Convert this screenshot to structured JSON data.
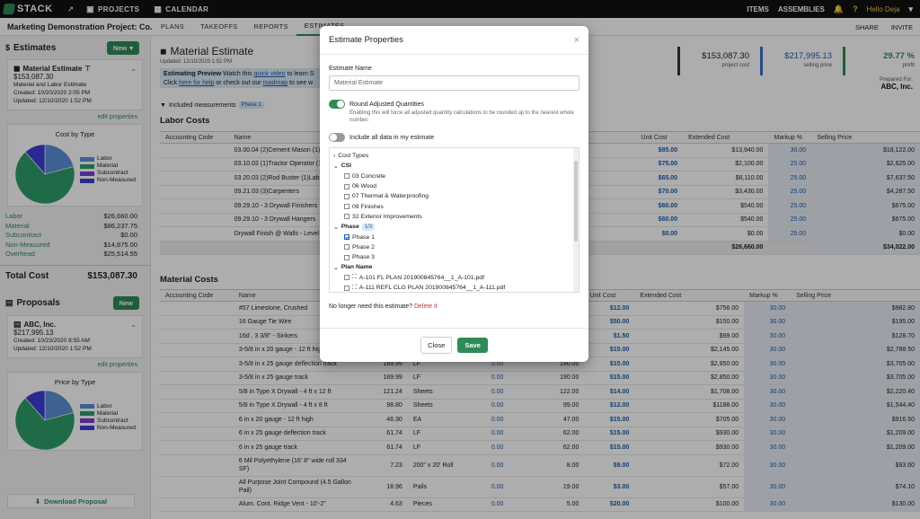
{
  "topbar": {
    "logo": "STACK",
    "projects": "PROJECTS",
    "calendar": "CALENDAR",
    "items": "ITEMS",
    "assemblies": "ASSEMBLIES",
    "hello": "Hello Deja"
  },
  "subbar": {
    "project": "Marketing Demonstration Project: Co...",
    "tabs": [
      "PLANS",
      "TAKEOFFS",
      "REPORTS",
      "ESTIMATES"
    ],
    "share": "SHARE",
    "invite": "INVITE"
  },
  "sidebar": {
    "estimates_title": "Estimates",
    "new_label": "New",
    "estimate_card": {
      "title": "Material Estimate",
      "amount": "$153,087.30",
      "desc": "Material and Labor Estimate",
      "created": "Created: 10/20/2020 2:05 PM",
      "updated": "Updated: 12/10/2020 1:52 PM"
    },
    "edit_properties": "edit properties",
    "cost_by_type": "Cost by Type",
    "legend": [
      "Labor",
      "Material",
      "Subcontract",
      "Non-Measured"
    ],
    "costs": [
      {
        "k": "Labor",
        "v": "$26,660.00"
      },
      {
        "k": "Material",
        "v": "$86,237.75"
      },
      {
        "k": "Subcontract",
        "v": "$0.00"
      },
      {
        "k": "Non-Measured",
        "v": "$14,675.00"
      },
      {
        "k": "Overhead",
        "v": "$25,514.55"
      }
    ],
    "total_label": "Total Cost",
    "total_value": "$153,087.30",
    "proposals_title": "Proposals",
    "proposal_new": "New",
    "proposal_card": {
      "title": "ABC, Inc.",
      "amount": "$217,995.13",
      "created": "Created: 10/23/2020 8:55 AM",
      "updated": "Updated: 12/10/2020 1:52 PM"
    },
    "edit_properties_2": "edit properties",
    "price_by_type": "Price by Type",
    "download": "Download Proposal"
  },
  "colors": {
    "labor": "#5b8fd6",
    "material": "#2e9e6a",
    "subcontract": "#7a3fd0",
    "non_measured": "#3d3dd6",
    "accent": "#2e8b57"
  },
  "main": {
    "title": "Material Estimate",
    "updated": "Updated: 12/10/2020 1:52 PM",
    "preview_line1_a": "Estimating Preview",
    "preview_line1_b": "Watch this",
    "preview_link1": "quick video",
    "preview_line1_c": "to learn S",
    "preview_line2_a": "Click",
    "preview_link2": "here for help",
    "preview_line2_b": "or check out our",
    "preview_link3": "roadmap",
    "preview_line2_c": "to see w",
    "included": "Included measurements",
    "phase_badge": "Phase 1",
    "kpis": [
      {
        "v": "$153,087.30",
        "l": "project cost"
      },
      {
        "v": "$217,995.13",
        "l": "selling price"
      },
      {
        "v": "29.77 %",
        "l": "profit"
      }
    ],
    "prepared_for": "Prepared For:",
    "prepared_name": "ABC, Inc.",
    "labor_title": "Labor Costs",
    "material_title": "Material Costs",
    "headers": {
      "acct": "Accounting Code",
      "name": "Name",
      "unit_cost": "Unit Cost",
      "ext": "Extended Cost",
      "markup": "Markup %",
      "selling": "Selling Price"
    },
    "labor_rows": [
      {
        "name": "03.00.04 (2)Cement Mason (1)",
        "uc": "$85.00",
        "ext": "$13,940.00",
        "mk": "30.00",
        "sp": "$18,122.00"
      },
      {
        "name": "03.10.02 (1)Tractor Operator (1)",
        "uc": "$75.00",
        "ext": "$2,100.00",
        "mk": "25.00",
        "sp": "$2,625.00"
      },
      {
        "name": "03.20.03 (2)Rod Buster (1)Lab",
        "uc": "$65.00",
        "ext": "$6,110.00",
        "mk": "25.00",
        "sp": "$7,637.50"
      },
      {
        "name": "09.21.03 (3)Carpenters",
        "uc": "$70.00",
        "ext": "$3,430.00",
        "mk": "25.00",
        "sp": "$4,287.50"
      },
      {
        "name": "09.29.10 - 3 Drywall Finishers",
        "uc": "$60.00",
        "ext": "$540.00",
        "mk": "25.00",
        "sp": "$675.00"
      },
      {
        "name": "09.29.10 - 3 Drywall Hangers",
        "uc": "$60.00",
        "ext": "$540.00",
        "mk": "25.00",
        "sp": "$675.00"
      },
      {
        "name": "Drywall Finish @ Walls - Level",
        "uc": "$0.00",
        "ext": "$0.00",
        "mk": "25.00",
        "sp": "$0.00"
      }
    ],
    "labor_total_ext": "$26,660.00",
    "labor_total_sp": "$34,022.00",
    "material_rows": [
      {
        "name": "#57 Limestone, Crushed",
        "q": "",
        "u": "",
        "a": "",
        "b": "",
        "uc": "$12.00",
        "ext": "$756.00",
        "mk": "30.00",
        "sp": "$982.80"
      },
      {
        "name": "16 Gauge Tie Wire",
        "q": "",
        "u": "",
        "a": "",
        "b": "",
        "uc": "$50.00",
        "ext": "$150.00",
        "mk": "30.00",
        "sp": "$195.00"
      },
      {
        "name": "16d , 3 3/8\" - Sinkers",
        "q": "",
        "u": "",
        "a": "",
        "b": "",
        "uc": "$1.50",
        "ext": "$99.00",
        "mk": "30.00",
        "sp": "$128.70"
      },
      {
        "name": "3-5/8 in x 20 gauge - 12 ft hig",
        "q": "",
        "u": "",
        "a": "",
        "b": "",
        "uc": "$15.00",
        "ext": "$2,145.00",
        "mk": "30.00",
        "sp": "$2,788.50"
      },
      {
        "name": "3-5/8 in x 25 gauge deflection track",
        "q": "189.99",
        "u": "LF",
        "a": "0.00",
        "b": "190.00",
        "uc": "$15.00",
        "ext": "$2,850.00",
        "mk": "30.00",
        "sp": "$3,705.00"
      },
      {
        "name": "3-5/8 in x 25 gauge track",
        "q": "189.99",
        "u": "LF",
        "a": "0.00",
        "b": "190.00",
        "uc": "$15.00",
        "ext": "$2,850.00",
        "mk": "30.00",
        "sp": "$3,705.00"
      },
      {
        "name": "5/8 in Type X Drywall - 4 ft x 12 ft",
        "q": "121.24",
        "u": "Sheets",
        "a": "0.00",
        "b": "122.00",
        "uc": "$14.00",
        "ext": "$1,708.00",
        "mk": "30.00",
        "sp": "$2,220.40"
      },
      {
        "name": "5/8 in Type X Drywall - 4 ft x 8 ft",
        "q": "98.80",
        "u": "Sheets",
        "a": "0.00",
        "b": "99.00",
        "uc": "$12.00",
        "ext": "$1188.00",
        "mk": "30.00",
        "sp": "$1,544.40"
      },
      {
        "name": "6 in x 20 gauge - 12 ft high",
        "q": "46.30",
        "u": "EA",
        "a": "0.00",
        "b": "47.00",
        "uc": "$15.00",
        "ext": "$705.00",
        "mk": "30.00",
        "sp": "$916.50"
      },
      {
        "name": "6 in x 25 gauge deflection track",
        "q": "61.74",
        "u": "LF",
        "a": "0.00",
        "b": "62.00",
        "uc": "$15.00",
        "ext": "$930.00",
        "mk": "30.00",
        "sp": "$1,209.00"
      },
      {
        "name": "6 in x 25 gauge track",
        "q": "61.74",
        "u": "LF",
        "a": "0.00",
        "b": "62.00",
        "uc": "$15.00",
        "ext": "$930.00",
        "mk": "30.00",
        "sp": "$1,209.00"
      },
      {
        "name": "6 Mil Polyethylene (16' 8\" wide roll 334 SF)",
        "q": "7.23",
        "u": "200\" x 20' Roll",
        "a": "0.00",
        "b": "8.00",
        "uc": "$9.00",
        "ext": "$72.00",
        "mk": "30.00",
        "sp": "$93.60"
      },
      {
        "name": "All Purpose Joint Compound (4.5 Gallon Pail)",
        "q": "18.96",
        "u": "Pails",
        "a": "0.00",
        "b": "19.00",
        "uc": "$3.00",
        "ext": "$57.00",
        "mk": "30.00",
        "sp": "$74.10"
      },
      {
        "name": "Alum. Cont. Ridge Vent - 10'-2\"",
        "q": "4.63",
        "u": "Pieces",
        "a": "0.00",
        "b": "5.00",
        "uc": "$20.00",
        "ext": "$100.00",
        "mk": "30.00",
        "sp": "$130.00"
      }
    ]
  },
  "modal": {
    "title": "Estimate Properties",
    "name_label": "Estimate Name",
    "name_value": "Material Estimate",
    "round_label": "Round Adjusted Quantities",
    "round_help": "Enabling this will force all adjusted quantity calculations to be rounded up to the nearest whole number.",
    "include_label": "Include all data in my estimate",
    "tree": {
      "cost_types": "Cost Types",
      "csi": "CSI",
      "csi_items": [
        "03 Concrete",
        "06 Wood",
        "07 Thermal & Waterproofing",
        "09 Finishes",
        "32 Exterior Improvements"
      ],
      "phase": "Phase",
      "phase_badge": "1/3",
      "phase_items": [
        "Phase 1",
        "Phase 2",
        "Phase 3"
      ],
      "plan_name": "Plan Name",
      "plan_items": [
        "A-101 FL PLAN 201900845764__1_A-101.pdf",
        "A-111 REFL CLG PLAN 201900845764__1_A-111.pdf"
      ]
    },
    "delete_prompt": "No longer need this estimate?",
    "delete_link": "Delete it",
    "close": "Close",
    "save": "Save"
  }
}
